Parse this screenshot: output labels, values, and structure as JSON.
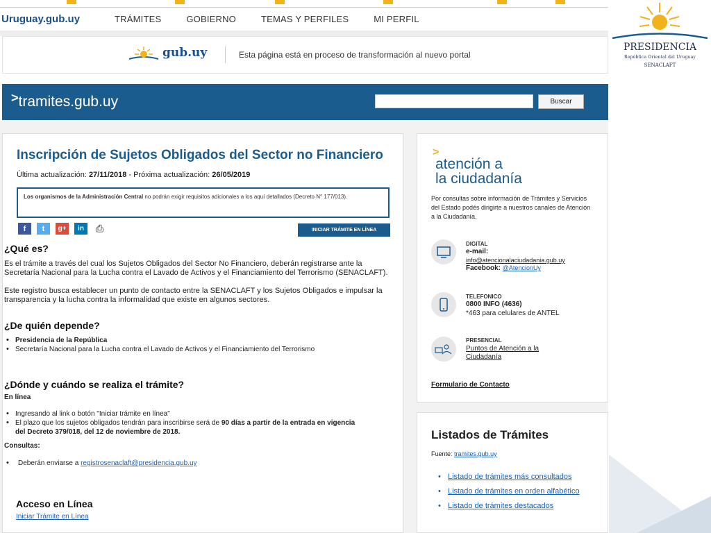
{
  "nav": {
    "brand": "Uruguay.gub.uy",
    "items": [
      "TRÁMITES",
      "GOBIERNO",
      "TEMAS Y PERFILES",
      "MI PERFIL"
    ]
  },
  "banner": {
    "logo_text": "gub.uy",
    "message": "Esta página está en proceso de transformación al nuevo portal"
  },
  "header": {
    "brand": "tramites.gub.uy",
    "search_placeholder": "",
    "search_button": "Buscar"
  },
  "main": {
    "title": "Inscripción de Sujetos Obligados del Sector no Financiero",
    "updated_label": "Última actualización:",
    "updated_value": "27/11/2018",
    "next_label": "- Próxima actualización:",
    "next_value": "26/05/2019",
    "note_bold": "Los organismos de la Administración Central",
    "note_rest": " no podrán exigir requisitos adicionales a los aquí detallados (Decreto N° 177/013).",
    "iniciar_button": "INICIAR TRÁMITE EN LÍNEA",
    "que_es_title": "¿Qué es?",
    "que_es_p1": "Es el trámite a través del cual los Sujetos Obligados del Sector No Financiero, deberán registrarse ante la Secretaría Nacional para la Lucha contra el Lavado de Activos y el Financiamiento del Terrorismo (SENACLAFT).",
    "que_es_p2": "Este registro busca establecer un punto de contacto entre la SENACLAFT y los Sujetos Obligados e impulsar la transparencia y la lucha contra la informalidad que existe en algunos sectores.",
    "depende_title": "¿De quién depende?",
    "depende_items": [
      "Presidencia de la República",
      "Secretaría Nacional para la Lucha contra el Lavado de Activos y el Financiamiento del Terrorismo"
    ],
    "donde_title": "¿Dónde y cuándo se realiza el trámite?",
    "en_linea": "En línea",
    "donde_item1": "Ingresando al link o botón \"Iniciar trámite en línea\"",
    "donde_item2_a": "El plazo que los sujetos obligados tendrán para inscribirse será de ",
    "donde_item2_b": "90 días a partir de la entrada en vigencia del Decreto 379/018, del 12 de noviembre de 2018.",
    "consultas": "Consultas:",
    "consultas_item_a": "Deberán enviarse a ",
    "consultas_link": "registrosenaclaft@presidencia.gub.uy",
    "acceso_title": "Acceso en Línea",
    "acceso_link": "Iniciar Trámite en Línea"
  },
  "atencion": {
    "title_line1": "atención a",
    "title_line2": "la ciudadanía",
    "desc": "Por consultas sobre información de Trámites y Servicios del Estado podés dirigirte a nuestros canales de Atención a la Ciudadanía.",
    "digital_label": "DIGITAL",
    "email_label": "e-mail:",
    "email": "info@atencionalaciudadania.gub.uy",
    "facebook_label": "Facebook:",
    "facebook": "@AtencionUy",
    "telefonico_label": "TELEFONICO",
    "phone": "0800 INFO (4636)",
    "phone_alt": "*463 para celulares de ANTEL",
    "presencial_label": "PRESENCIAL",
    "presencial_link1": "Puntos de Atención a la",
    "presencial_link2": "Ciudadanía",
    "form_link": "Formulario de Contacto"
  },
  "listados": {
    "title": "Listados de Trámites",
    "source_label": "Fuente:",
    "source_link": "tramites.gub.uy",
    "items": [
      "Listado de trámites más consultados",
      "Listado de trámites en orden alfabético",
      "Listado de trámites destacados"
    ]
  },
  "presidencia": {
    "name": "PRESIDENCIA",
    "sub": "República Oriental del Uruguay",
    "sub2": "SENACLAFT"
  },
  "colors": {
    "brand_blue": "#1b5c8e",
    "sun_yellow": "#f2b21c"
  }
}
